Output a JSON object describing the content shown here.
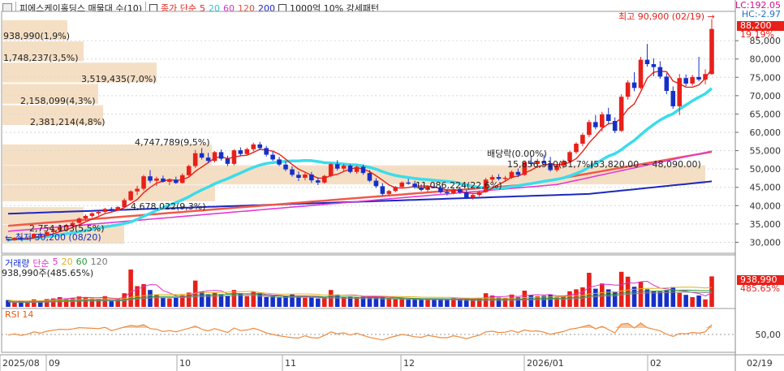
{
  "header": {
    "stock_name": "피에스케이홀딩스",
    "indicator": "매물대 수(10)",
    "ma_title": "종가 단순",
    "ma_periods": [
      "5",
      "20",
      "60",
      "120",
      "200"
    ],
    "pattern": "1000억 10% 강세패턴"
  },
  "volume_legend": {
    "title": "거래량",
    "ma_title": "단순",
    "ma_periods": [
      "5",
      "20",
      "60",
      "120"
    ],
    "current": "938,990주(485.65%)"
  },
  "rsi_legend": {
    "title": "RSI 14"
  },
  "colors": {
    "up": "#e8201a",
    "down": "#1530c8",
    "ma5": "#e8201a",
    "ma20": "#3bdcea",
    "ma60": "#e23ad8",
    "ma120": "#f05a4a",
    "ma200": "#1c28c0",
    "profile": "#f5dfc4",
    "rsi": "#f08a3c"
  },
  "chart_data": [
    {
      "type": "candlestick",
      "x_labels": [
        "2025/08",
        "09",
        "10",
        "11",
        "12",
        "2026/01",
        "02",
        "02/19"
      ],
      "y_ticks": [
        "30,000",
        "35,000",
        "40,000",
        "45,000",
        "50,000",
        "55,000",
        "60,000",
        "65,000",
        "70,000",
        "75,000",
        "80,000",
        "85,000"
      ],
      "ylim": [
        27000,
        93000
      ],
      "price_labels": {
        "lc": "LC:192.05",
        "hc": "HC:-2.97",
        "last": "88,200",
        "change": "19.19%"
      },
      "annotations": {
        "high": "최고 90,900 (02/19)",
        "low": "최저 30,200 (08/20)",
        "dividend": "배당락(0.00%)",
        "range": "(53,820.00 ~ 48,090.00)"
      },
      "candles": [
        [
          30800,
          31100,
          30200,
          30600
        ],
        [
          30600,
          31400,
          30400,
          31200
        ],
        [
          31200,
          31500,
          30600,
          30900
        ],
        [
          30900,
          31300,
          30600,
          31100
        ],
        [
          31100,
          32500,
          31000,
          32300
        ],
        [
          32300,
          32700,
          31600,
          32000
        ],
        [
          32000,
          33000,
          31800,
          32800
        ],
        [
          32800,
          33600,
          32400,
          33300
        ],
        [
          33300,
          34500,
          33000,
          34200
        ],
        [
          34200,
          35000,
          33600,
          34700
        ],
        [
          34700,
          35600,
          34300,
          35300
        ],
        [
          35300,
          36800,
          35200,
          36500
        ],
        [
          36500,
          37600,
          35900,
          37200
        ],
        [
          37200,
          38200,
          36700,
          37900
        ],
        [
          37900,
          38600,
          37300,
          38300
        ],
        [
          38300,
          39400,
          38000,
          39100
        ],
        [
          39100,
          39600,
          38400,
          38800
        ],
        [
          38800,
          39900,
          38600,
          39600
        ],
        [
          39600,
          42000,
          39400,
          41500
        ],
        [
          41500,
          44200,
          41200,
          43900
        ],
        [
          43900,
          45400,
          42900,
          44600
        ],
        [
          44600,
          48400,
          44100,
          48000
        ],
        [
          48000,
          49700,
          46200,
          46800
        ],
        [
          46800,
          47900,
          45400,
          47400
        ],
        [
          47400,
          48200,
          46300,
          46500
        ],
        [
          46500,
          47400,
          45600,
          47100
        ],
        [
          47100,
          47900,
          45900,
          46200
        ],
        [
          46200,
          48800,
          46000,
          48300
        ],
        [
          48300,
          51200,
          47900,
          50800
        ],
        [
          50800,
          55200,
          50300,
          54300
        ],
        [
          54300,
          55700,
          52600,
          53100
        ],
        [
          53100,
          54400,
          51600,
          52200
        ],
        [
          52200,
          54900,
          51800,
          54600
        ],
        [
          54600,
          55300,
          52300,
          52800
        ],
        [
          52800,
          53600,
          50800,
          51400
        ],
        [
          51400,
          55400,
          51000,
          55100
        ],
        [
          55100,
          55900,
          53600,
          54100
        ],
        [
          54100,
          55800,
          53900,
          55400
        ],
        [
          55400,
          57200,
          54800,
          56700
        ],
        [
          56700,
          57400,
          55100,
          55700
        ],
        [
          55700,
          56300,
          53400,
          53900
        ],
        [
          53900,
          54700,
          52200,
          52600
        ],
        [
          52600,
          53300,
          50800,
          51200
        ],
        [
          51200,
          52100,
          49400,
          49900
        ],
        [
          49900,
          50700,
          47900,
          48400
        ],
        [
          48400,
          49300,
          46700,
          47600
        ],
        [
          47600,
          48900,
          46900,
          48500
        ],
        [
          48500,
          49200,
          46200,
          46900
        ],
        [
          46900,
          47600,
          45600,
          46300
        ],
        [
          46300,
          48400,
          46000,
          48100
        ],
        [
          48100,
          51600,
          47800,
          51300
        ],
        [
          51300,
          52400,
          49600,
          50100
        ],
        [
          50100,
          51400,
          49400,
          50900
        ],
        [
          50900,
          51300,
          48800,
          49200
        ],
        [
          49200,
          50900,
          48700,
          50600
        ],
        [
          50600,
          51200,
          48400,
          48900
        ],
        [
          48900,
          49700,
          46400,
          46800
        ],
        [
          46800,
          47500,
          44800,
          45300
        ],
        [
          45300,
          46100,
          42700,
          43200
        ],
        [
          43200,
          44300,
          42600,
          44000
        ],
        [
          44000,
          45400,
          43600,
          45100
        ],
        [
          45100,
          46600,
          44800,
          46300
        ],
        [
          46300,
          47300,
          45700,
          46000
        ],
        [
          46000,
          46800,
          44600,
          45000
        ],
        [
          45000,
          45800,
          43900,
          44300
        ],
        [
          44300,
          45600,
          43800,
          45200
        ],
        [
          45200,
          46300,
          44700,
          44900
        ],
        [
          44900,
          45400,
          43300,
          43700
        ],
        [
          43700,
          44400,
          42800,
          43400
        ],
        [
          43400,
          45000,
          43100,
          44500
        ],
        [
          44500,
          45200,
          43200,
          43600
        ],
        [
          43600,
          44300,
          41800,
          42200
        ],
        [
          42200,
          43400,
          41600,
          42900
        ],
        [
          42900,
          44100,
          42500,
          43700
        ],
        [
          43700,
          47600,
          43500,
          47100
        ],
        [
          47100,
          48400,
          46400,
          47800
        ],
        [
          47800,
          48600,
          46900,
          47300
        ],
        [
          47300,
          48100,
          46500,
          47600
        ],
        [
          47600,
          49600,
          47300,
          49200
        ],
        [
          49200,
          50100,
          47800,
          48400
        ],
        [
          48400,
          52300,
          48100,
          51800
        ],
        [
          51800,
          53600,
          50900,
          51400
        ],
        [
          51400,
          52800,
          50300,
          52200
        ],
        [
          52200,
          53900,
          51100,
          51600
        ],
        [
          51600,
          53300,
          49300,
          49700
        ],
        [
          49700,
          51300,
          49200,
          50900
        ],
        [
          50900,
          52600,
          50200,
          52100
        ],
        [
          52100,
          55000,
          51800,
          54600
        ],
        [
          54600,
          57300,
          54100,
          56900
        ],
        [
          56900,
          59800,
          56200,
          59300
        ],
        [
          59300,
          63400,
          58700,
          62800
        ],
        [
          62800,
          64700,
          60800,
          61400
        ],
        [
          61400,
          65600,
          60200,
          64900
        ],
        [
          64900,
          66700,
          62400,
          63100
        ],
        [
          63100,
          64100,
          59800,
          60400
        ],
        [
          60400,
          70400,
          60100,
          69700
        ],
        [
          69700,
          74200,
          68900,
          73600
        ],
        [
          73600,
          76400,
          71200,
          72100
        ],
        [
          72100,
          80600,
          71800,
          79800
        ],
        [
          79800,
          84100,
          77900,
          78600
        ],
        [
          78600,
          80200,
          75300,
          77800
        ],
        [
          77800,
          79400,
          74600,
          75200
        ],
        [
          75200,
          76100,
          70400,
          71300
        ],
        [
          71300,
          72500,
          66400,
          67100
        ],
        [
          67100,
          75900,
          64700,
          74800
        ],
        [
          74800,
          75800,
          72600,
          73300
        ],
        [
          73300,
          75700,
          72700,
          75100
        ],
        [
          75100,
          80600,
          73900,
          74400
        ],
        [
          74400,
          77200,
          73100,
          75900
        ],
        [
          75900,
          90900,
          75700,
          88200
        ]
      ],
      "volume_ylim": [
        0,
        1200000
      ],
      "volume_marks": [
        "938,990",
        "485.65%"
      ],
      "volumes": [
        210000,
        150000,
        180000,
        170000,
        230000,
        190000,
        240000,
        260000,
        300000,
        260000,
        280000,
        320000,
        300000,
        260000,
        250000,
        330000,
        210000,
        240000,
        420000,
        1150000,
        640000,
        700000,
        520000,
        380000,
        290000,
        260000,
        280000,
        360000,
        440000,
        810000,
        460000,
        390000,
        430000,
        380000,
        340000,
        520000,
        390000,
        330000,
        460000,
        410000,
        300000,
        330000,
        290000,
        340000,
        380000,
        310000,
        280000,
        300000,
        260000,
        310000,
        520000,
        380000,
        300000,
        320000,
        290000,
        310000,
        340000,
        320000,
        300000,
        280000,
        240000,
        260000,
        230000,
        250000,
        220000,
        240000,
        260000,
        250000,
        230000,
        270000,
        230000,
        260000,
        240000,
        280000,
        420000,
        350000,
        290000,
        270000,
        380000,
        300000,
        500000,
        360000,
        330000,
        340000,
        370000,
        290000,
        340000,
        480000,
        540000,
        600000,
        1050000,
        560000,
        720000,
        540000,
        470000,
        1080000,
        930000,
        620000,
        770000,
        540000,
        480000,
        470000,
        520000,
        610000,
        430000,
        370000,
        300000,
        350000,
        230000,
        938990
      ],
      "rsi_ticks": [
        "50,00"
      ],
      "rsi": [
        48,
        52,
        47,
        51,
        58,
        54,
        60,
        63,
        66,
        65,
        67,
        71,
        70,
        69,
        68,
        72,
        62,
        67,
        73,
        78,
        75,
        80,
        68,
        66,
        59,
        62,
        58,
        64,
        69,
        76,
        66,
        61,
        68,
        62,
        56,
        70,
        62,
        64,
        69,
        63,
        55,
        50,
        46,
        43,
        40,
        39,
        46,
        40,
        39,
        47,
        58,
        52,
        55,
        48,
        54,
        47,
        41,
        37,
        33,
        40,
        45,
        50,
        47,
        43,
        41,
        47,
        44,
        40,
        40,
        46,
        42,
        37,
        43,
        48,
        58,
        60,
        56,
        57,
        62,
        56,
        64,
        60,
        61,
        57,
        50,
        55,
        59,
        66,
        69,
        74,
        79,
        67,
        75,
        65,
        55,
        82,
        84,
        70,
        85,
        71,
        66,
        61,
        51,
        44,
        53,
        52,
        56,
        54,
        58,
        80
      ]
    }
  ]
}
